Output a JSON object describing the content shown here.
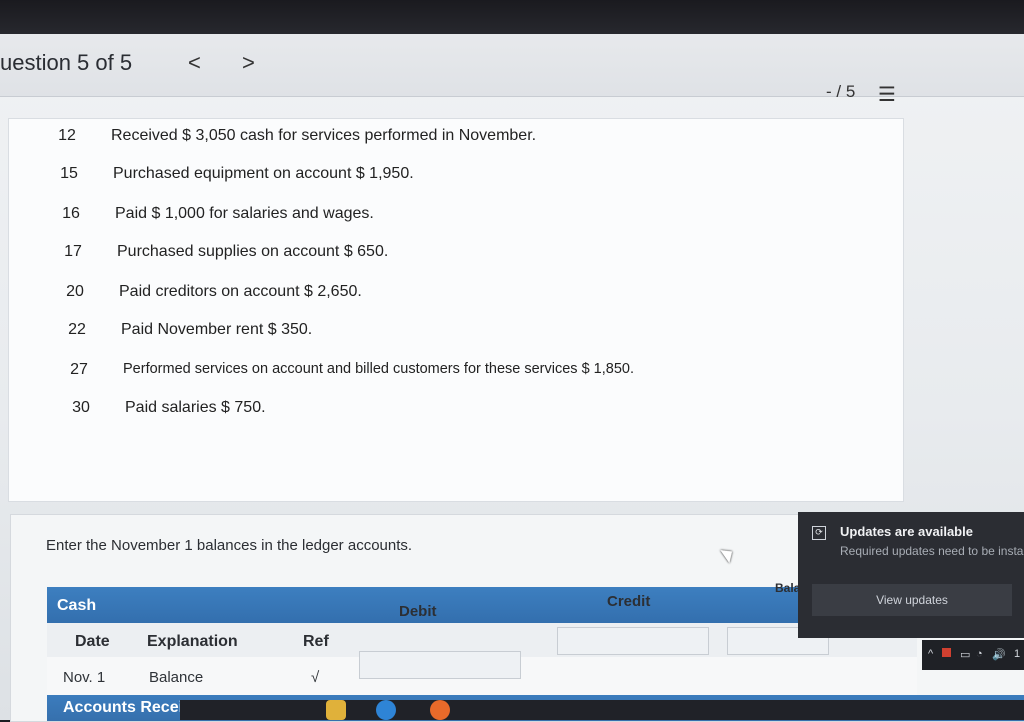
{
  "header": {
    "question_title": "uestion 5 of 5",
    "prev": "<",
    "next": ">",
    "score": "- / 5",
    "list_icon": "list-icon"
  },
  "transactions": [
    {
      "day": "12",
      "text": "Received $ 3,050 cash for services performed in November."
    },
    {
      "day": "15",
      "text": "Purchased equipment on account $ 1,950."
    },
    {
      "day": "16",
      "text": "Paid $ 1,000 for salaries and wages."
    },
    {
      "day": "17",
      "text": "Purchased supplies on account $ 650."
    },
    {
      "day": "20",
      "text": "Paid creditors on account $ 2,650."
    },
    {
      "day": "22",
      "text": "Paid November rent $ 350."
    },
    {
      "day": "27",
      "text": "Performed services on account and billed customers for these services $ 1,850."
    },
    {
      "day": "30",
      "text": "Paid salaries $ 750."
    }
  ],
  "ledger": {
    "instruction": "Enter the November 1 balances in the ledger accounts.",
    "account1": "Cash",
    "columns": {
      "date": "Date",
      "explanation": "Explanation",
      "ref": "Ref",
      "debit": "Debit",
      "credit": "Credit",
      "balance": "Bala"
    },
    "row1": {
      "date": "Nov. 1",
      "explanation": "Balance",
      "ref": "√",
      "debit": "",
      "credit": "",
      "balance": ""
    },
    "account2": "Accounts Receivable"
  },
  "notification": {
    "title": "Updates are available",
    "body": "Required updates need to be insta",
    "button": "View updates"
  },
  "taskbar": {
    "icons": [
      "file-explorer-icon",
      "edge-icon",
      "firefox-icon"
    ],
    "tray_time": "1"
  },
  "colors": {
    "accent": "#3a79ba",
    "toast_bg": "#2b2d33"
  }
}
